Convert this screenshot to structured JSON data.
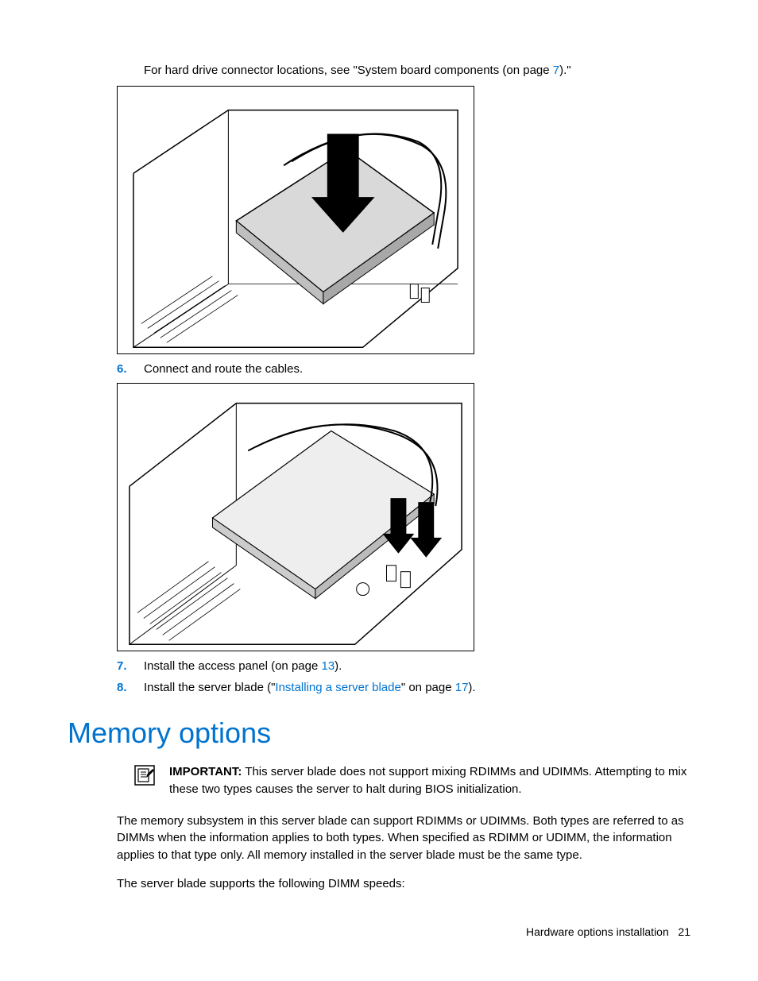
{
  "lead": {
    "pre": "For hard drive connector locations, see \"System board components (on page ",
    "page_ref": "7",
    "post": ").\""
  },
  "steps": {
    "s6": {
      "num": "6.",
      "text": "Connect and route the cables."
    },
    "s7": {
      "num": "7.",
      "pre": "Install the access panel (on page ",
      "page_ref": "13",
      "post": ")."
    },
    "s8": {
      "num": "8.",
      "pre": "Install the server blade (\"",
      "link": "Installing a server blade",
      "mid": "\" on page ",
      "page_ref": "17",
      "post": ")."
    }
  },
  "heading": "Memory options",
  "important": {
    "label": "IMPORTANT:",
    "text": "  This server blade does not support mixing RDIMMs and UDIMMs. Attempting to mix these two types causes the server to halt during BIOS initialization."
  },
  "para1": "The memory subsystem in this server blade can support RDIMMs or UDIMMs. Both types are referred to as DIMMs when the information applies to both types. When specified as RDIMM or UDIMM, the information applies to that type only. All memory installed in the server blade must be the same type.",
  "para2": "The server blade supports the following DIMM speeds:",
  "footer": {
    "section": "Hardware options installation",
    "page": "21"
  }
}
